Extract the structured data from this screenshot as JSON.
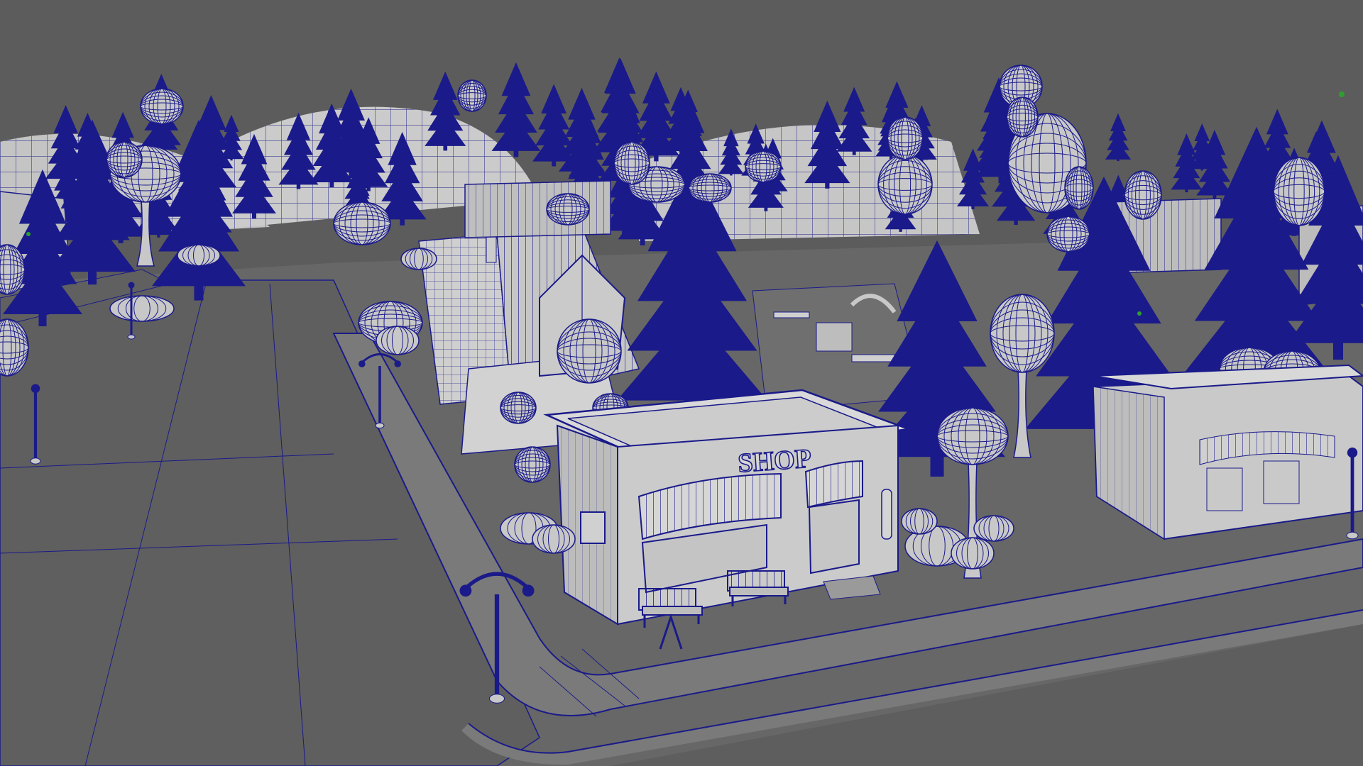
{
  "viewport": {
    "background": "#5c5c5c",
    "wire_color": "#1a1a8a",
    "surface_color": "#c8c8c8",
    "ground_color": "#6a6a6a",
    "road_color": "#5e5e5e",
    "selection_marker_color": "#2e9e2e"
  },
  "scene": {
    "shop_sign": "SHOP"
  }
}
